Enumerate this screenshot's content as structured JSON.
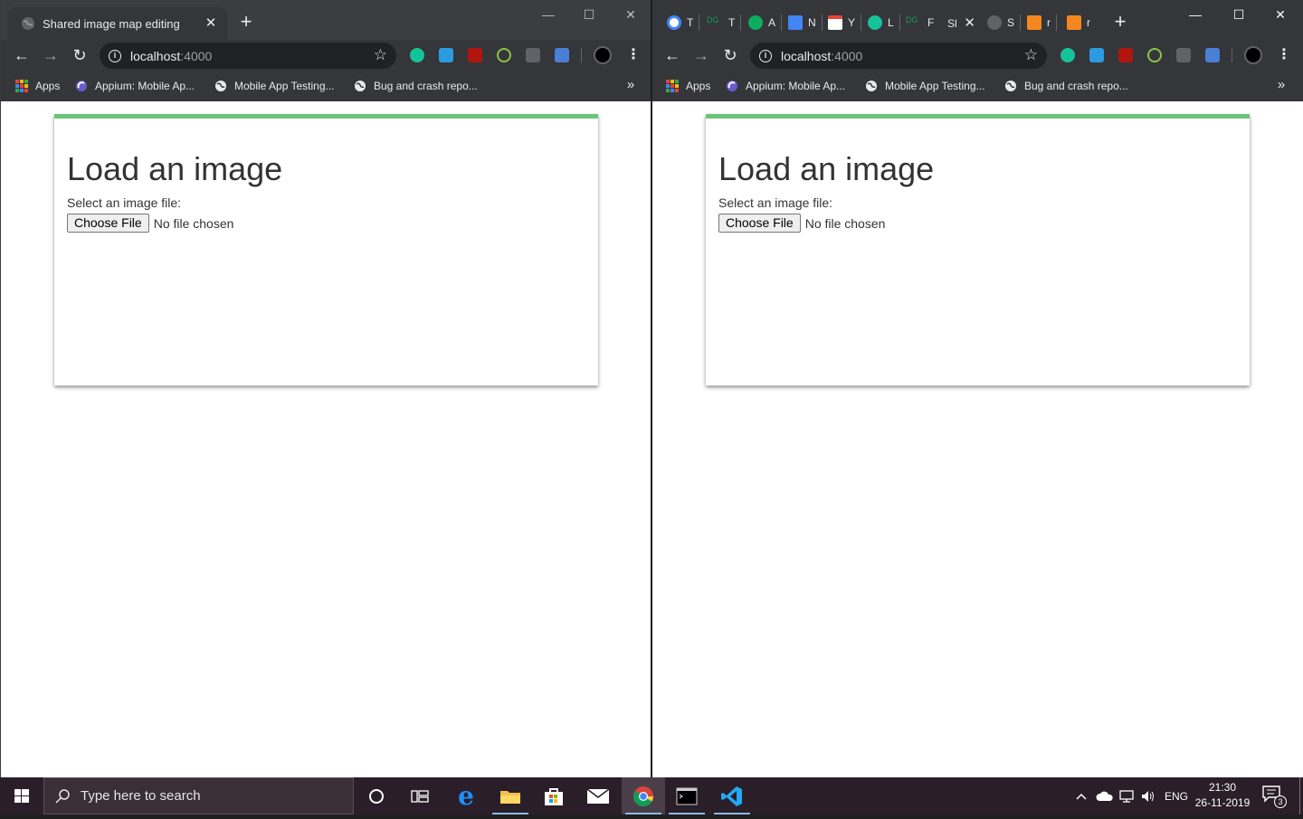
{
  "left_window": {
    "tab_title": "Shared image map editing",
    "url_host": "localhost",
    "url_port": ":4000",
    "window_controls": {
      "minimize": "—",
      "maximize": "☐",
      "close": "✕"
    }
  },
  "right_window": {
    "tabs": [
      {
        "letter": "T",
        "icon": "google-icon"
      },
      {
        "letter": "T",
        "icon": "dg-icon"
      },
      {
        "letter": "A",
        "icon": "h-icon"
      },
      {
        "letter": "N",
        "icon": "docs-icon"
      },
      {
        "letter": "Y",
        "icon": "gmail-icon"
      },
      {
        "letter": "L",
        "icon": "grammarly-icon"
      },
      {
        "letter": "F",
        "icon": "dg-icon"
      }
    ],
    "active_tab_title": "Sl",
    "after_tabs": [
      {
        "letter": "S",
        "icon": "globe-icon"
      },
      {
        "letter": "r",
        "icon": "orange-icon"
      },
      {
        "letter": "r",
        "icon": "orange-icon"
      }
    ],
    "url_host": "localhost",
    "url_port": ":4000",
    "window_controls": {
      "minimize": "—",
      "maximize": "☐",
      "close": "✕"
    }
  },
  "bookmarks": [
    {
      "label": "Apps",
      "icon": "apps-grid-icon"
    },
    {
      "label": "Appium: Mobile Ap...",
      "icon": "appium-icon"
    },
    {
      "label": "Mobile App Testing...",
      "icon": "globe-icon"
    },
    {
      "label": "Bug and crash repo...",
      "icon": "globe-icon"
    }
  ],
  "bookmarks_more": "»",
  "page": {
    "heading": "Load an image",
    "label": "Select an image file:",
    "choose_button": "Choose File",
    "file_status": "No file chosen"
  },
  "taskbar": {
    "search_placeholder": "Type here to search",
    "language": "ENG",
    "time": "21:30",
    "date": "26-11-2019",
    "notification_count": "3"
  },
  "colors": {
    "chrome_dark": "#35363a",
    "omnibox": "#202124",
    "card_accent": "#6cc47a",
    "taskbar": "#2a1e28"
  }
}
